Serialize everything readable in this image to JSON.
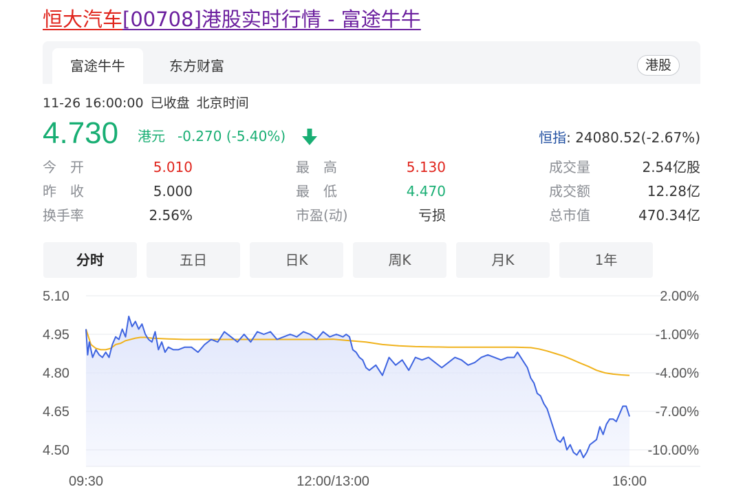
{
  "page_title": {
    "part_red": "恒大汽车",
    "part_purple": "[00708]港股实时行情 - 富途牛牛"
  },
  "source_tabs": [
    {
      "label": "富途牛牛",
      "active": true
    },
    {
      "label": "东方财富",
      "active": false
    }
  ],
  "market_badge": "港股",
  "status": {
    "datetime": "11-26 16:00:00",
    "state": "已收盘",
    "timezone": "北京时间"
  },
  "quote": {
    "price": "4.730",
    "currency": "港元",
    "change": "-0.270 (-5.40%)",
    "direction": "down",
    "color": "#18ae73"
  },
  "index": {
    "name": "恒指",
    "value": ": 24080.52(-2.67%)"
  },
  "stats": [
    {
      "label": "今　开",
      "value": "5.010",
      "tone": "red"
    },
    {
      "label": "最　高",
      "value": "5.130",
      "tone": "red"
    },
    {
      "label": "成交量",
      "value": "2.54亿股",
      "tone": "neutral"
    },
    {
      "label": "昨　收",
      "value": "5.000",
      "tone": "neutral"
    },
    {
      "label": "最　低",
      "value": "4.470",
      "tone": "green"
    },
    {
      "label": "成交额",
      "value": "12.28亿",
      "tone": "neutral"
    },
    {
      "label": "换手率",
      "value": "2.56%",
      "tone": "neutral"
    },
    {
      "label": "市盈(动)",
      "value": "亏损",
      "tone": "neutral"
    },
    {
      "label": "总市值",
      "value": "470.34亿",
      "tone": "neutral"
    }
  ],
  "periods": [
    {
      "label": "分时",
      "active": true
    },
    {
      "label": "五日",
      "active": false
    },
    {
      "label": "日K",
      "active": false
    },
    {
      "label": "周K",
      "active": false
    },
    {
      "label": "月K",
      "active": false
    },
    {
      "label": "1年",
      "active": false
    }
  ],
  "colors": {
    "up": "#e0241c",
    "down": "#18ae73",
    "price_line": "#3d63e0",
    "avg_line": "#f0b21b",
    "area_fill": "#dfe5fb"
  },
  "chart_data": {
    "type": "line",
    "x_range": [
      0,
      330
    ],
    "x_ticks": [
      {
        "x": 0,
        "label": "09:30"
      },
      {
        "x": 150,
        "label": "12:00/13:00"
      },
      {
        "x": 330,
        "label": "16:00"
      }
    ],
    "ylim": [
      4.45,
      5.1
    ],
    "y_ticks_left": [
      "5.10",
      "4.95",
      "4.80",
      "4.65",
      "4.50"
    ],
    "y_ticks_left_values": [
      5.1,
      4.95,
      4.8,
      4.65,
      4.5
    ],
    "y_ticks_right": [
      "2.00%",
      "-1.00%",
      "-4.00%",
      "-7.00%",
      "-10.00%"
    ],
    "grid": true,
    "series": [
      {
        "key": "price",
        "x": [
          0,
          1,
          2,
          4,
          6,
          8,
          10,
          12,
          14,
          16,
          18,
          20,
          22,
          24,
          25,
          26,
          28,
          30,
          32,
          34,
          36,
          38,
          40,
          42,
          44,
          46,
          48,
          50,
          53,
          56,
          60,
          64,
          68,
          72,
          76,
          80,
          84,
          88,
          92,
          96,
          100,
          104,
          108,
          112,
          116,
          120,
          124,
          128,
          132,
          136,
          140,
          144,
          148,
          152,
          156,
          158,
          160,
          162,
          164,
          166,
          168,
          170,
          172,
          176,
          180,
          184,
          188,
          192,
          196,
          200,
          204,
          208,
          212,
          216,
          220,
          224,
          228,
          232,
          236,
          240,
          244,
          248,
          252,
          256,
          260,
          262,
          264,
          266,
          268,
          270,
          272,
          274,
          276,
          278,
          280,
          282,
          284,
          286,
          288,
          290,
          292,
          294,
          296,
          298,
          300,
          302,
          304,
          306,
          308,
          310,
          312,
          314,
          316,
          318,
          320,
          322,
          324,
          326,
          328,
          330
        ],
        "y": [
          4.97,
          4.87,
          4.92,
          4.86,
          4.89,
          4.87,
          4.86,
          4.88,
          4.86,
          4.91,
          4.94,
          4.93,
          4.97,
          4.94,
          4.98,
          5.02,
          4.98,
          5.0,
          4.97,
          4.99,
          4.95,
          4.93,
          4.92,
          4.96,
          4.89,
          4.92,
          4.88,
          4.9,
          4.89,
          4.89,
          4.9,
          4.9,
          4.88,
          4.91,
          4.93,
          4.92,
          4.96,
          4.94,
          4.92,
          4.95,
          4.92,
          4.96,
          4.95,
          4.96,
          4.93,
          4.94,
          4.95,
          4.94,
          4.96,
          4.95,
          4.93,
          4.96,
          4.94,
          4.95,
          4.94,
          4.95,
          4.94,
          4.89,
          4.88,
          4.86,
          4.85,
          4.82,
          4.81,
          4.83,
          4.79,
          4.86,
          4.83,
          4.85,
          4.81,
          4.86,
          4.85,
          4.86,
          4.84,
          4.82,
          4.84,
          4.86,
          4.85,
          4.83,
          4.84,
          4.86,
          4.87,
          4.86,
          4.85,
          4.86,
          4.86,
          4.88,
          4.86,
          4.84,
          4.82,
          4.78,
          4.76,
          4.72,
          4.71,
          4.68,
          4.66,
          4.62,
          4.58,
          4.54,
          4.53,
          4.55,
          4.5,
          4.52,
          4.49,
          4.48,
          4.5,
          4.47,
          4.49,
          4.52,
          4.53,
          4.54,
          4.59,
          4.56,
          4.6,
          4.62,
          4.62,
          4.61,
          4.64,
          4.67,
          4.67,
          4.63
        ]
      },
      {
        "key": "average",
        "x": [
          0,
          3,
          6,
          9,
          12,
          15,
          18,
          21,
          24,
          27,
          30,
          33,
          36,
          40,
          50,
          60,
          70,
          80,
          100,
          120,
          140,
          150,
          160,
          170,
          180,
          190,
          200,
          220,
          240,
          260,
          270,
          275,
          280,
          285,
          290,
          295,
          300,
          305,
          310,
          315,
          320,
          325,
          330
        ],
        "y": [
          4.97,
          4.91,
          4.895,
          4.89,
          4.89,
          4.895,
          4.91,
          4.915,
          4.925,
          4.93,
          4.935,
          4.938,
          4.938,
          4.935,
          4.932,
          4.93,
          4.93,
          4.93,
          4.93,
          4.93,
          4.93,
          4.931,
          4.925,
          4.92,
          4.91,
          4.905,
          4.902,
          4.9,
          4.9,
          4.9,
          4.898,
          4.893,
          4.885,
          4.875,
          4.865,
          4.852,
          4.838,
          4.825,
          4.81,
          4.8,
          4.795,
          4.792,
          4.79
        ]
      }
    ]
  }
}
